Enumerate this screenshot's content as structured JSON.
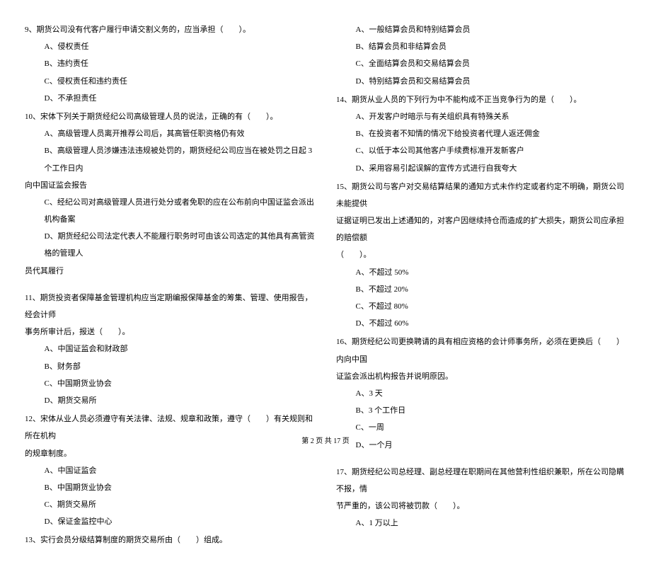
{
  "left_col": {
    "q9": {
      "text": "9、期货公司没有代客户履行申请交割义务的，应当承担（　　）。",
      "opts": [
        "A、侵权责任",
        "B、违约责任",
        "C、侵权责任和违约责任",
        "D、不承担责任"
      ]
    },
    "q10": {
      "text": "10、宋体下列关于期货经纪公司高级管理人员的说法，正确的有（　　）。",
      "optA": "A、高级管理人员离开推荐公司后，其高管任职资格仍有效",
      "optB1": "B、高级管理人员涉嫌违法违规被处罚的，期货经纪公司应当在被处罚之日起 3 个工作日内",
      "optB2": "向中国证监会报告",
      "optC": "C、经纪公司对高级管理人员进行处分或者免职的应在公布前向中国证监会派出机构备案",
      "optD1": "D、期货经纪公司法定代表人不能履行职务时可由该公司选定的其他具有高管资格的管理人",
      "optD2": "员代其履行"
    },
    "q11": {
      "line1": "11、期货投资者保障基金管理机构应当定期编报保障基金的筹集、管理、使用报告，经会计师",
      "line2": "事务所审计后，报送（　　）。",
      "opts": [
        "A、中国证监会和财政部",
        "B、财务部",
        "C、中国期货业协会",
        "D、期货交易所"
      ]
    },
    "q12": {
      "line1": "12、宋体从业人员必须遵守有关法律、法规、规章和政策，遵守（　　）有关规则和所在机构",
      "line2": "的规章制度。",
      "opts": [
        "A、中国证监会",
        "B、中国期货业协会",
        "C、期货交易所",
        "D、保证金监控中心"
      ]
    },
    "q13": {
      "text": "13、实行会员分级结算制度的期货交易所由（　　）组成。"
    }
  },
  "right_col": {
    "q13opts": [
      "A、一般结算会员和特别结算会员",
      "B、结算会员和非结算会员",
      "C、全面结算会员和交易结算会员",
      "D、特别结算会员和交易结算会员"
    ],
    "q14": {
      "text": "14、期货从业人员的下列行为中不能构成不正当竞争行为的是（　　）。",
      "opts": [
        "A、开发客户时暗示与有关组织具有特殊关系",
        "B、在投资者不知情的情况下给投资者代理人返还佣金",
        "C、以低于本公司其他客户手续费标准开发新客户",
        "D、采用容易引起误解的宣传方式进行自我夸大"
      ]
    },
    "q15": {
      "line1": "15、期货公司与客户对交易结算结果的通知方式未作约定或者约定不明确，期货公司未能提供",
      "line2": "证据证明已发出上述通知的，对客户因继续持仓而造成的扩大损失，期货公司应承担的赔偿额",
      "line3": "（　　）。",
      "opts": [
        "A、不超过 50%",
        "B、不超过 20%",
        "C、不超过 80%",
        "D、不超过 60%"
      ]
    },
    "q16": {
      "line1": "16、期货经纪公司更换聘请的具有相应资格的会计师事务所，必须在更换后（　　）内向中国",
      "line2": "证监会派出机构报告并说明原因。",
      "opts": [
        "A、3 天",
        "B、3 个工作日",
        "C、一周",
        "D、一个月"
      ]
    },
    "q17": {
      "line1": "17、期货经纪公司总经理、副总经理在职期间在其他营利性组织兼职，所在公司隐瞒不报，情",
      "line2": "节严重的，该公司将被罚款（　　）。",
      "optA": "A、1 万以上"
    }
  },
  "footer": "第 2 页 共 17 页"
}
